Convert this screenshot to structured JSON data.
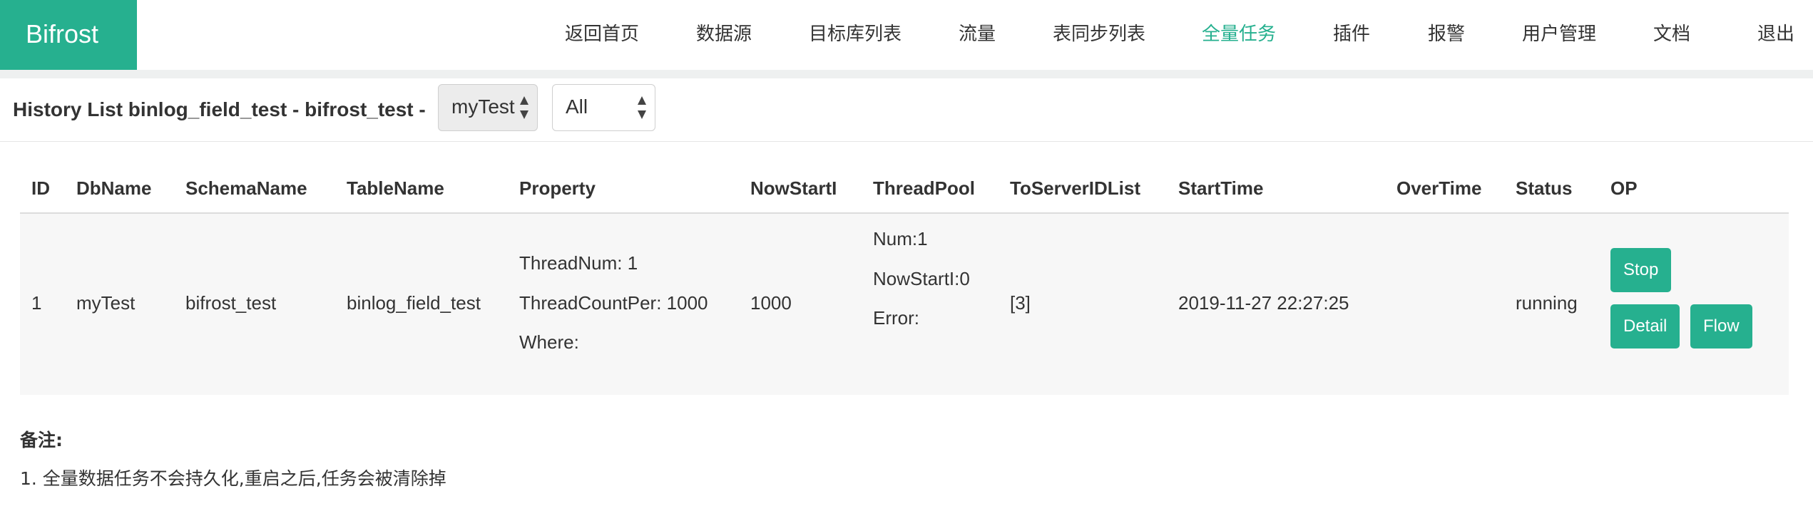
{
  "app": {
    "logo": "Bifrost"
  },
  "nav": {
    "items": [
      {
        "label": "返回首页"
      },
      {
        "label": "数据源"
      },
      {
        "label": "目标库列表"
      },
      {
        "label": "流量"
      },
      {
        "label": "表同步列表"
      },
      {
        "label": "全量任务",
        "active": true
      },
      {
        "label": "插件"
      },
      {
        "label": "报警"
      },
      {
        "label": "用户管理"
      },
      {
        "label": "文档"
      },
      {
        "label": "退出"
      }
    ]
  },
  "page": {
    "title": "History List binlog_field_test - bifrost_test -",
    "db_select": {
      "value": "myTest"
    },
    "status_select": {
      "value": "All"
    }
  },
  "table": {
    "headers": [
      "ID",
      "DbName",
      "SchemaName",
      "TableName",
      "Property",
      "NowStartI",
      "ThreadPool",
      "ToServerIDList",
      "StartTime",
      "OverTime",
      "Status",
      "OP"
    ],
    "rows": [
      {
        "id": "1",
        "db_name": "myTest",
        "schema_name": "bifrost_test",
        "table_name": "binlog_field_test",
        "property": [
          "ThreadNum: 1",
          "ThreadCountPer: 1000",
          "Where:"
        ],
        "now_start_i": "1000",
        "thread_pool": [
          "Num:1",
          "NowStartI:0",
          "Error:"
        ],
        "to_server_id_list": "[3]",
        "start_time": "2019-11-27 22:27:25",
        "over_time": "",
        "status": "running",
        "op": {
          "stop": "Stop",
          "detail": "Detail",
          "flow": "Flow"
        }
      }
    ]
  },
  "notes": {
    "title": "备注:",
    "items": [
      "1. 全量数据任务不会持久化,重启之后,任务会被清除掉"
    ]
  },
  "colors": {
    "accent": "#26b08f",
    "row_bg": "#f7f7f7",
    "band": "#eef0f0"
  }
}
